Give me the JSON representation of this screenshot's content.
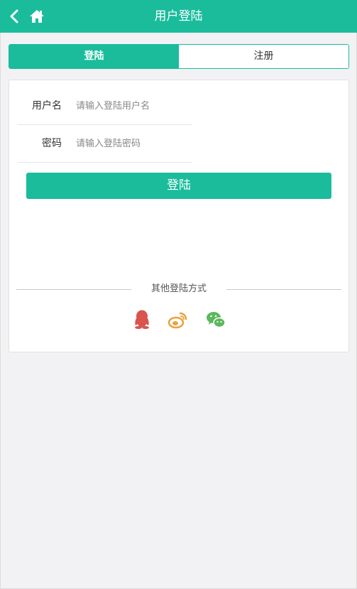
{
  "header": {
    "title": "用户登陆",
    "back_icon": "chevron-left-icon",
    "home_icon": "home-icon"
  },
  "tabs": [
    {
      "label": "登陆",
      "active": true
    },
    {
      "label": "注册",
      "active": false
    }
  ],
  "form": {
    "username_label": "用户名",
    "username_placeholder": "请输入登陆用户名",
    "username_value": "",
    "password_label": "密码",
    "password_placeholder": "请输入登陆密码",
    "password_value": "",
    "submit_label": "登陆"
  },
  "other_login": {
    "label": "其他登陆方式",
    "providers": [
      {
        "icon": "qq-icon",
        "color": "#d9534f"
      },
      {
        "icon": "weibo-icon",
        "color": "#e8a33d"
      },
      {
        "icon": "wechat-icon",
        "color": "#5cb85c"
      }
    ]
  },
  "colors": {
    "accent": "#1abc9c",
    "background": "#f2f2f4"
  }
}
